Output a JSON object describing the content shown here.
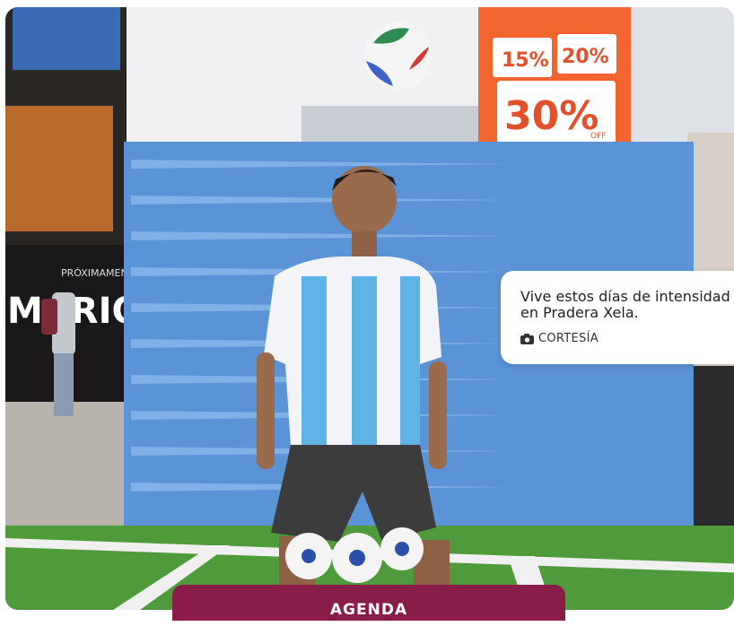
{
  "caption": {
    "text": "Vive estos días de intensidad en Pradera Xela.",
    "credit": "CORTESÍA",
    "credit_icon": "camera-icon"
  },
  "agenda_button": {
    "label": "AGENDA"
  },
  "photo_signs": {
    "discount_a": "15%",
    "discount_b": "20%",
    "discount_main": "30%",
    "discount_suffix": "OFF",
    "store_banner": "PRÓXIMAMENTE",
    "store_name": "MARIO"
  },
  "colors": {
    "accent": "#8a1c4a",
    "promo_orange": "#f2652f",
    "backdrop_blue": "#5a93d6"
  }
}
